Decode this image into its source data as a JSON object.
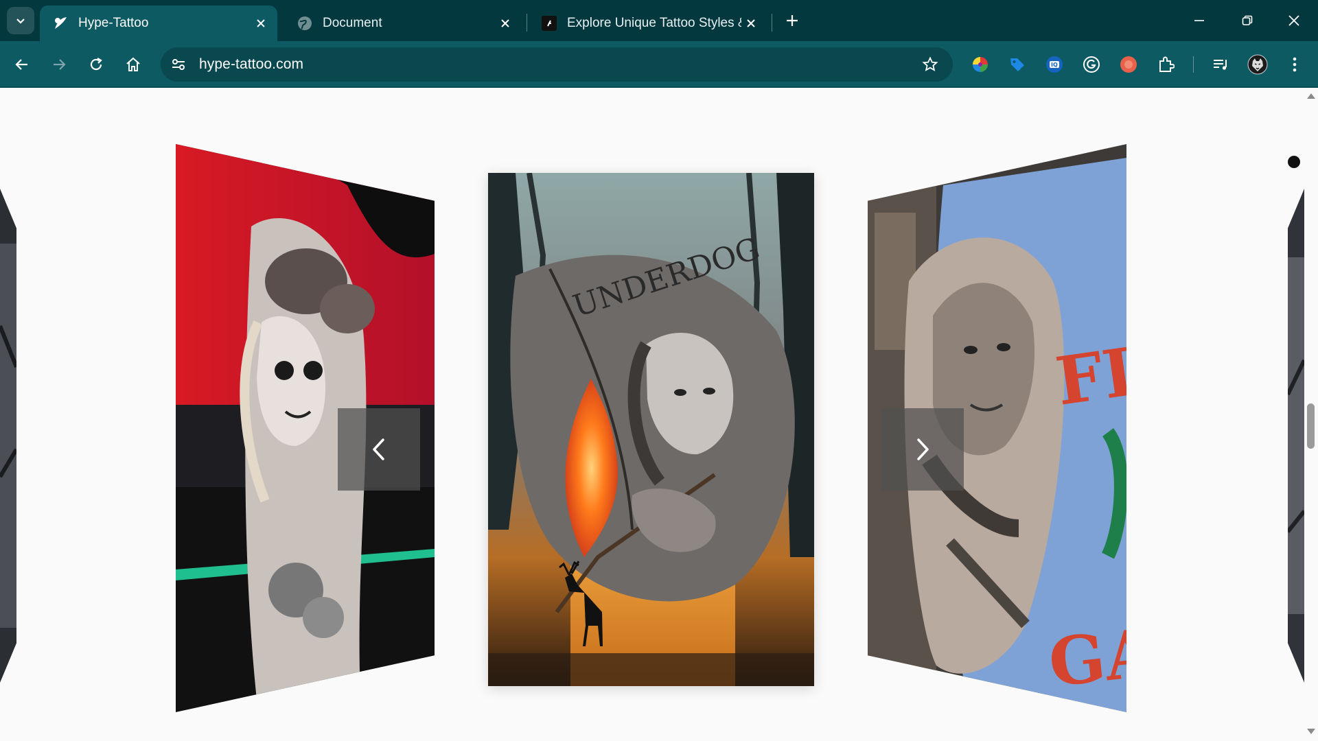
{
  "browser": {
    "tabs": [
      {
        "title": "Hype-Tattoo",
        "active": true,
        "favicon": "hype-tattoo-logo-icon"
      },
      {
        "title": "Document",
        "active": false,
        "favicon": "globe-icon"
      },
      {
        "title": "Explore Unique Tattoo Styles &",
        "active": false,
        "favicon": "tattoo-site-icon"
      }
    ],
    "url": "hype-tattoo.com",
    "accent": "#0d5a63",
    "titlebar_color": "#04383f"
  },
  "extensions": [
    "color-wheel-icon",
    "tag-extension-icon",
    "iq-extension-icon",
    "grammarly-icon",
    "tools-extension-icon",
    "puzzle-extensions-icon",
    "media-control-icon",
    "profile-avatar-icon",
    "more-menu-icon"
  ],
  "carousel": {
    "slides": [
      {
        "name": "left-edge-slide",
        "alt": "Tattoo slide partially visible"
      },
      {
        "name": "sugar-skull-woman-tattoo",
        "alt": "Sugar skull woman with roses thigh tattoo"
      },
      {
        "name": "underdog-archer-tattoo",
        "alt": "Underdog archer woman with fire arrow and deer",
        "caption": "UNDERDOG"
      },
      {
        "name": "gladiator-shoulder-tattoo",
        "alt": "Realistic gladiator portrait shoulder tattoo"
      },
      {
        "name": "right-edge-slide",
        "alt": "Tattoo slide partially visible"
      }
    ],
    "prev_label": "‹",
    "next_label": "›"
  }
}
